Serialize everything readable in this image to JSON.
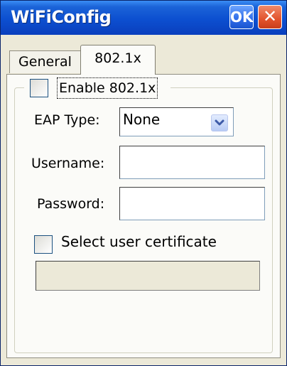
{
  "window": {
    "title": "WiFiConfig",
    "ok_label": "OK",
    "close_label": "✕"
  },
  "tabs": [
    {
      "label": "General",
      "active": false
    },
    {
      "label": "802.1x",
      "active": true
    }
  ],
  "form": {
    "enable_label": "Enable 802.1x",
    "enable_checked": false,
    "eap_label": "EAP Type:",
    "eap_value": "None",
    "username_label": "Username:",
    "username_value": "",
    "password_label": "Password:",
    "password_value": "",
    "cert_label": "Select user certificate",
    "cert_checked": false,
    "cert_value": ""
  },
  "colors": {
    "titlebar": "#0c4fd0",
    "ok_button": "#2e6be8",
    "close_button": "#e2532c",
    "dialog_bg": "#ece9d8",
    "panel_bg": "#fbfbf8"
  }
}
